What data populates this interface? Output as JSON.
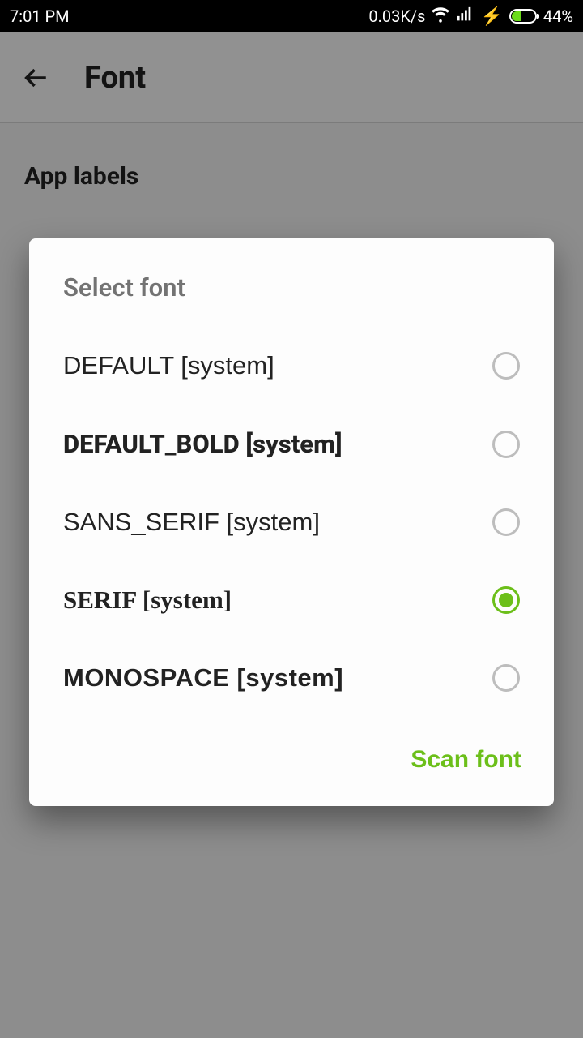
{
  "statusbar": {
    "time": "7:01 PM",
    "speed": "0.03K/s",
    "battery_pct": "44%"
  },
  "header": {
    "title": "Font"
  },
  "section": {
    "label": "App labels"
  },
  "dialog": {
    "title": "Select font",
    "action_label": "Scan font",
    "options": [
      {
        "label": "DEFAULT [system]",
        "selected": false
      },
      {
        "label": "DEFAULT_BOLD [system]",
        "selected": false
      },
      {
        "label": "SANS_SERIF [system]",
        "selected": false
      },
      {
        "label": "SERIF [system]",
        "selected": true
      },
      {
        "label": "MONOSPACE [system]",
        "selected": false
      }
    ]
  }
}
